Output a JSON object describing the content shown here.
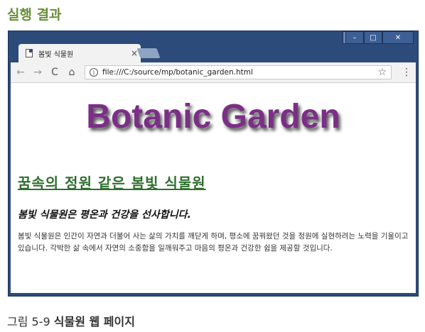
{
  "header": {
    "title": "실행 결과"
  },
  "browser": {
    "tab": {
      "title": "봄빛 식물원",
      "close": "×"
    },
    "window_buttons": {
      "minimize": "–",
      "maximize": "□",
      "close": "✕"
    },
    "nav": {
      "back": "←",
      "forward": "→",
      "reload": "C",
      "home": "⌂"
    },
    "address": {
      "url": "file:///C:/source/mp/botanic_garden.html"
    },
    "menu_icon": "⋮",
    "star_icon": "☆"
  },
  "page": {
    "title": "Botanic Garden",
    "subtitle": "꿈속의 정원 같은 봄빛 식물원",
    "tagline": "봄빛 식물원은 평온과 건강을 선사합니다.",
    "paragraph": "봄빛 식물원은 인간이 자연과 더불어 사는 삶의 가치를 깨닫게 하며, 평소에 꿈꿔왔던 것을 정원에 실현하려는 노력을 기울이고 있습니다. 각박한 삶 속에서 자연의 소중함을 일깨워주고 마음의 평온과 건강한 쉼을 제공할 것입니다."
  },
  "caption": {
    "number": "그림 5-9",
    "text": "식물원 웹 페이지"
  },
  "colors": {
    "frame": "#2c4a7a",
    "title_purple": "#7b2f86",
    "heading_green": "#2f6e2f",
    "label_green": "#6b8e3a"
  }
}
